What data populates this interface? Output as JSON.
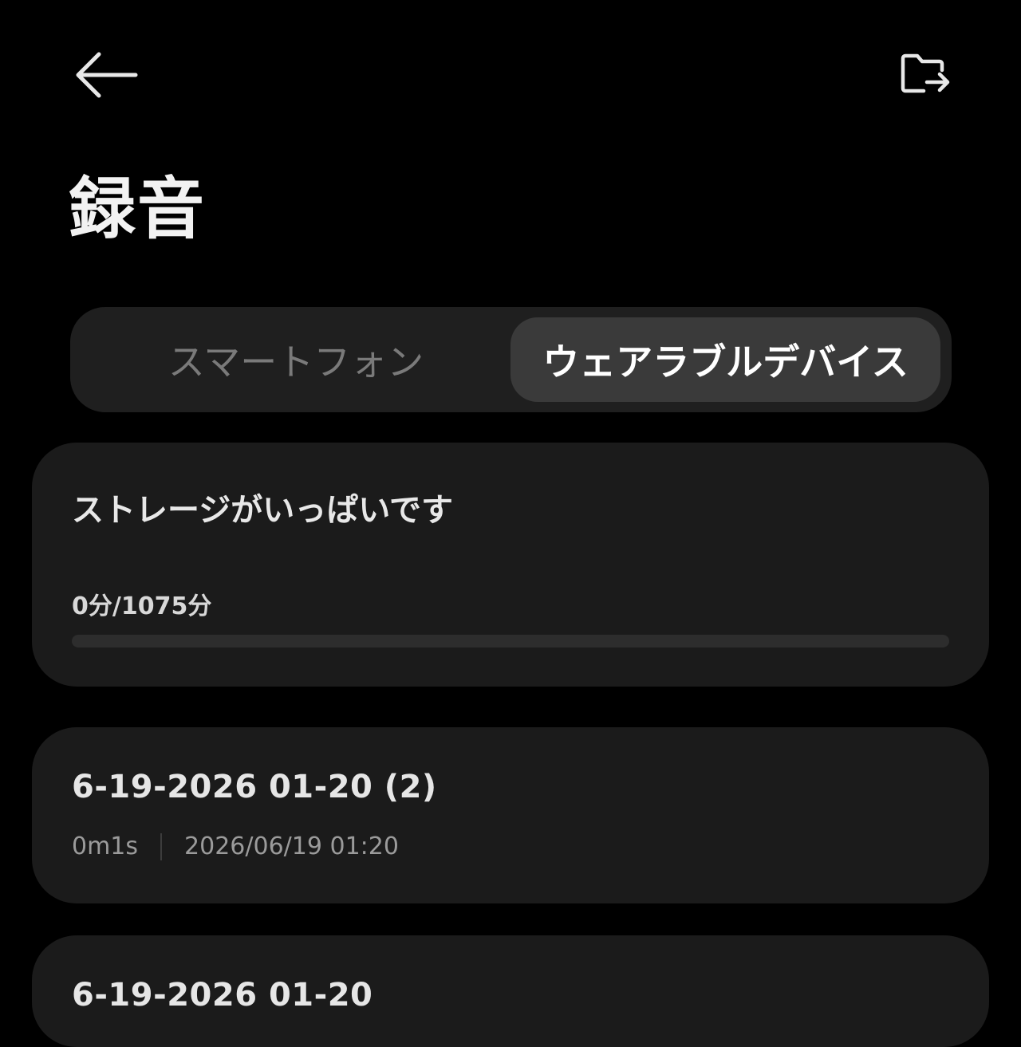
{
  "header": {
    "back_icon": "arrow-left-icon",
    "export_icon": "folder-export-icon",
    "title": "録音"
  },
  "tabs": {
    "items": [
      {
        "label": "スマートフォン",
        "selected": false
      },
      {
        "label": "ウェアラブルデバイス",
        "selected": true
      }
    ]
  },
  "storage": {
    "title": "ストレージがいっぱいです",
    "usage_text": "0分/1075分",
    "used_minutes": 0,
    "total_minutes": 1075
  },
  "recordings": [
    {
      "name": "6-19-2026 01-20 (2)",
      "duration": "0m1s",
      "datetime": "2026/06/19 01:20"
    },
    {
      "name": "6-19-2026 01-20"
    }
  ],
  "colors": {
    "background": "#000000",
    "card": "#1b1b1b",
    "segment_selected": "#3a3a3a",
    "progress_accent": "#4a7cf0"
  }
}
